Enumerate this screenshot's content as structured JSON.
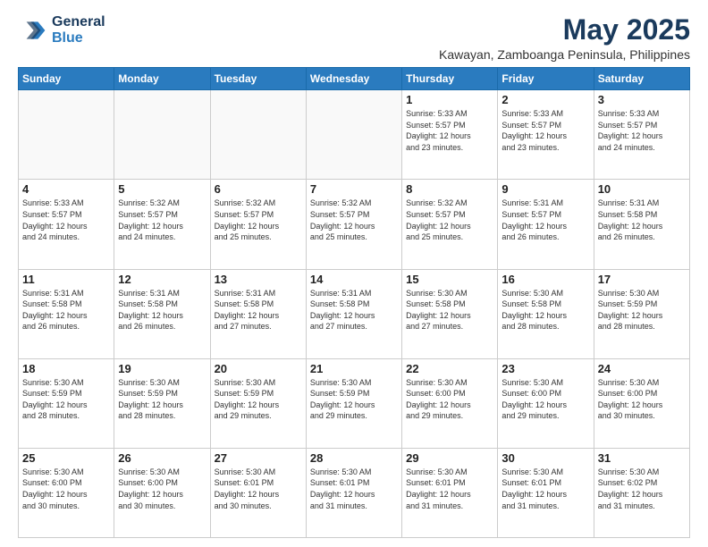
{
  "header": {
    "logo_general": "General",
    "logo_blue": "Blue",
    "month_title": "May 2025",
    "location": "Kawayan, Zamboanga Peninsula, Philippines"
  },
  "days_of_week": [
    "Sunday",
    "Monday",
    "Tuesday",
    "Wednesday",
    "Thursday",
    "Friday",
    "Saturday"
  ],
  "weeks": [
    [
      {
        "num": "",
        "info": ""
      },
      {
        "num": "",
        "info": ""
      },
      {
        "num": "",
        "info": ""
      },
      {
        "num": "",
        "info": ""
      },
      {
        "num": "1",
        "info": "Sunrise: 5:33 AM\nSunset: 5:57 PM\nDaylight: 12 hours\nand 23 minutes."
      },
      {
        "num": "2",
        "info": "Sunrise: 5:33 AM\nSunset: 5:57 PM\nDaylight: 12 hours\nand 23 minutes."
      },
      {
        "num": "3",
        "info": "Sunrise: 5:33 AM\nSunset: 5:57 PM\nDaylight: 12 hours\nand 24 minutes."
      }
    ],
    [
      {
        "num": "4",
        "info": "Sunrise: 5:33 AM\nSunset: 5:57 PM\nDaylight: 12 hours\nand 24 minutes."
      },
      {
        "num": "5",
        "info": "Sunrise: 5:32 AM\nSunset: 5:57 PM\nDaylight: 12 hours\nand 24 minutes."
      },
      {
        "num": "6",
        "info": "Sunrise: 5:32 AM\nSunset: 5:57 PM\nDaylight: 12 hours\nand 25 minutes."
      },
      {
        "num": "7",
        "info": "Sunrise: 5:32 AM\nSunset: 5:57 PM\nDaylight: 12 hours\nand 25 minutes."
      },
      {
        "num": "8",
        "info": "Sunrise: 5:32 AM\nSunset: 5:57 PM\nDaylight: 12 hours\nand 25 minutes."
      },
      {
        "num": "9",
        "info": "Sunrise: 5:31 AM\nSunset: 5:57 PM\nDaylight: 12 hours\nand 26 minutes."
      },
      {
        "num": "10",
        "info": "Sunrise: 5:31 AM\nSunset: 5:58 PM\nDaylight: 12 hours\nand 26 minutes."
      }
    ],
    [
      {
        "num": "11",
        "info": "Sunrise: 5:31 AM\nSunset: 5:58 PM\nDaylight: 12 hours\nand 26 minutes."
      },
      {
        "num": "12",
        "info": "Sunrise: 5:31 AM\nSunset: 5:58 PM\nDaylight: 12 hours\nand 26 minutes."
      },
      {
        "num": "13",
        "info": "Sunrise: 5:31 AM\nSunset: 5:58 PM\nDaylight: 12 hours\nand 27 minutes."
      },
      {
        "num": "14",
        "info": "Sunrise: 5:31 AM\nSunset: 5:58 PM\nDaylight: 12 hours\nand 27 minutes."
      },
      {
        "num": "15",
        "info": "Sunrise: 5:30 AM\nSunset: 5:58 PM\nDaylight: 12 hours\nand 27 minutes."
      },
      {
        "num": "16",
        "info": "Sunrise: 5:30 AM\nSunset: 5:58 PM\nDaylight: 12 hours\nand 28 minutes."
      },
      {
        "num": "17",
        "info": "Sunrise: 5:30 AM\nSunset: 5:59 PM\nDaylight: 12 hours\nand 28 minutes."
      }
    ],
    [
      {
        "num": "18",
        "info": "Sunrise: 5:30 AM\nSunset: 5:59 PM\nDaylight: 12 hours\nand 28 minutes."
      },
      {
        "num": "19",
        "info": "Sunrise: 5:30 AM\nSunset: 5:59 PM\nDaylight: 12 hours\nand 28 minutes."
      },
      {
        "num": "20",
        "info": "Sunrise: 5:30 AM\nSunset: 5:59 PM\nDaylight: 12 hours\nand 29 minutes."
      },
      {
        "num": "21",
        "info": "Sunrise: 5:30 AM\nSunset: 5:59 PM\nDaylight: 12 hours\nand 29 minutes."
      },
      {
        "num": "22",
        "info": "Sunrise: 5:30 AM\nSunset: 6:00 PM\nDaylight: 12 hours\nand 29 minutes."
      },
      {
        "num": "23",
        "info": "Sunrise: 5:30 AM\nSunset: 6:00 PM\nDaylight: 12 hours\nand 29 minutes."
      },
      {
        "num": "24",
        "info": "Sunrise: 5:30 AM\nSunset: 6:00 PM\nDaylight: 12 hours\nand 30 minutes."
      }
    ],
    [
      {
        "num": "25",
        "info": "Sunrise: 5:30 AM\nSunset: 6:00 PM\nDaylight: 12 hours\nand 30 minutes."
      },
      {
        "num": "26",
        "info": "Sunrise: 5:30 AM\nSunset: 6:00 PM\nDaylight: 12 hours\nand 30 minutes."
      },
      {
        "num": "27",
        "info": "Sunrise: 5:30 AM\nSunset: 6:01 PM\nDaylight: 12 hours\nand 30 minutes."
      },
      {
        "num": "28",
        "info": "Sunrise: 5:30 AM\nSunset: 6:01 PM\nDaylight: 12 hours\nand 31 minutes."
      },
      {
        "num": "29",
        "info": "Sunrise: 5:30 AM\nSunset: 6:01 PM\nDaylight: 12 hours\nand 31 minutes."
      },
      {
        "num": "30",
        "info": "Sunrise: 5:30 AM\nSunset: 6:01 PM\nDaylight: 12 hours\nand 31 minutes."
      },
      {
        "num": "31",
        "info": "Sunrise: 5:30 AM\nSunset: 6:02 PM\nDaylight: 12 hours\nand 31 minutes."
      }
    ]
  ]
}
